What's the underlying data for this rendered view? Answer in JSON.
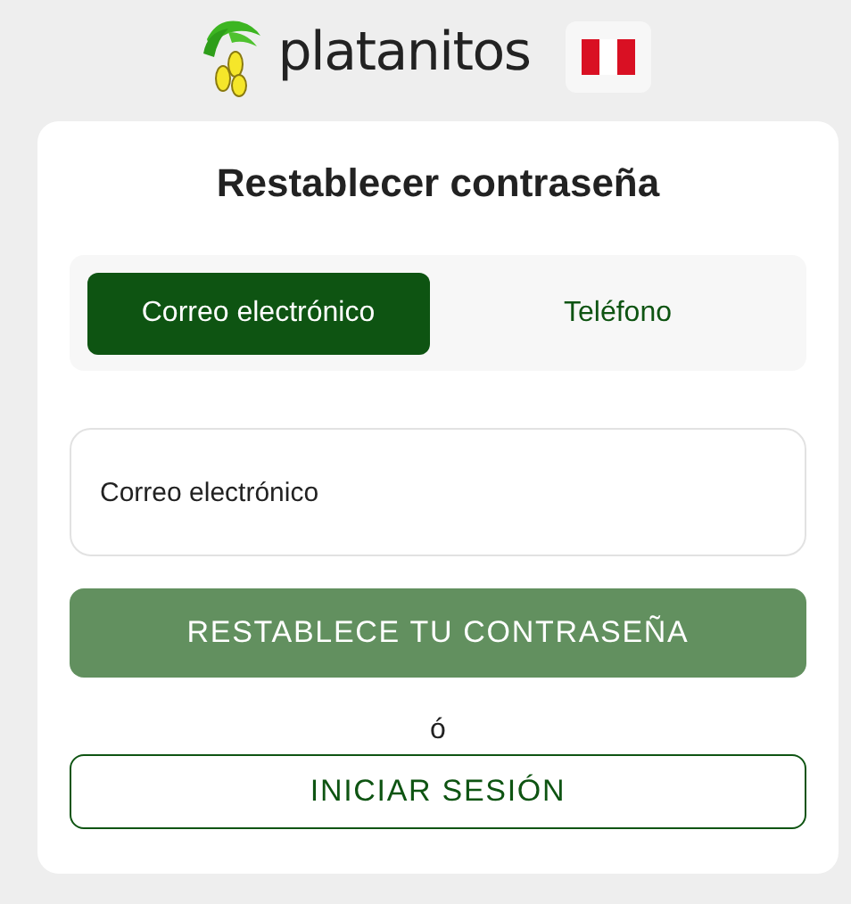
{
  "header": {
    "brand": "platanitos"
  },
  "title": "Restablecer contraseña",
  "tabs": [
    {
      "label": "Correo electrónico",
      "selected": true
    },
    {
      "label": "Teléfono",
      "selected": false
    }
  ],
  "email_field": {
    "placeholder": "Correo electrónico"
  },
  "reset_button": {
    "label": "RESTABLECE TU CONTRASEÑA",
    "disabled": true
  },
  "separator": "ó",
  "login_button": {
    "label": "INICIAR SESIÓN"
  }
}
